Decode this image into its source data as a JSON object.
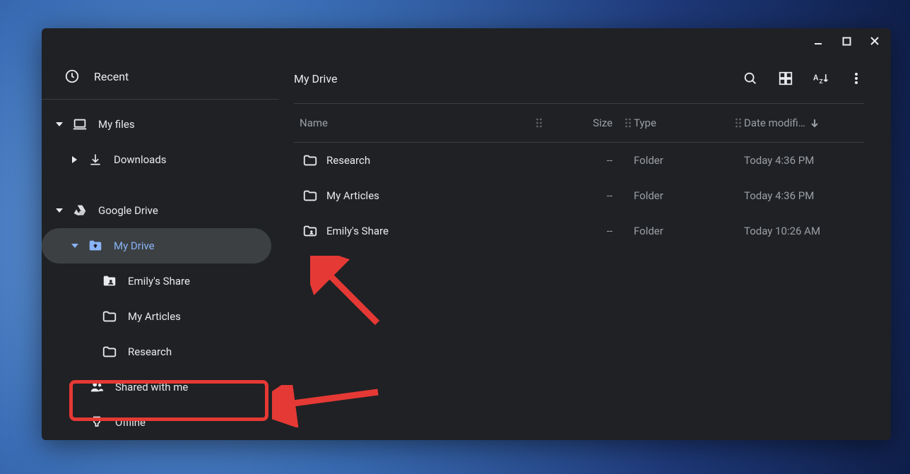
{
  "window": {
    "titlebar": {
      "minimize": "–",
      "maximize": "▢",
      "close": "✕"
    }
  },
  "sidebar": {
    "recent_label": "Recent",
    "items": {
      "my_files": "My files",
      "downloads": "Downloads",
      "google_drive": "Google Drive",
      "my_drive": "My Drive",
      "emilys_share": "Emily's Share",
      "my_articles": "My Articles",
      "research": "Research",
      "shared_with_me": "Shared with me",
      "offline": "Offline"
    }
  },
  "breadcrumb": {
    "title": "My Drive"
  },
  "toolbar": {
    "search": "Search",
    "view": "Grid view",
    "sort": "Sort AZ",
    "more": "More"
  },
  "columns": {
    "name": "Name",
    "size": "Size",
    "type": "Type",
    "date": "Date modifi…"
  },
  "rows": [
    {
      "name": "Research",
      "size": "--",
      "type": "Folder",
      "date": "Today 4:36 PM",
      "icon": "folder"
    },
    {
      "name": "My Articles",
      "size": "--",
      "type": "Folder",
      "date": "Today 4:36 PM",
      "icon": "folder"
    },
    {
      "name": "Emily's Share",
      "size": "--",
      "type": "Folder",
      "date": "Today 10:26 AM",
      "icon": "folder-shared"
    }
  ],
  "annotations": {
    "highlight_target": "shared_with_me"
  }
}
